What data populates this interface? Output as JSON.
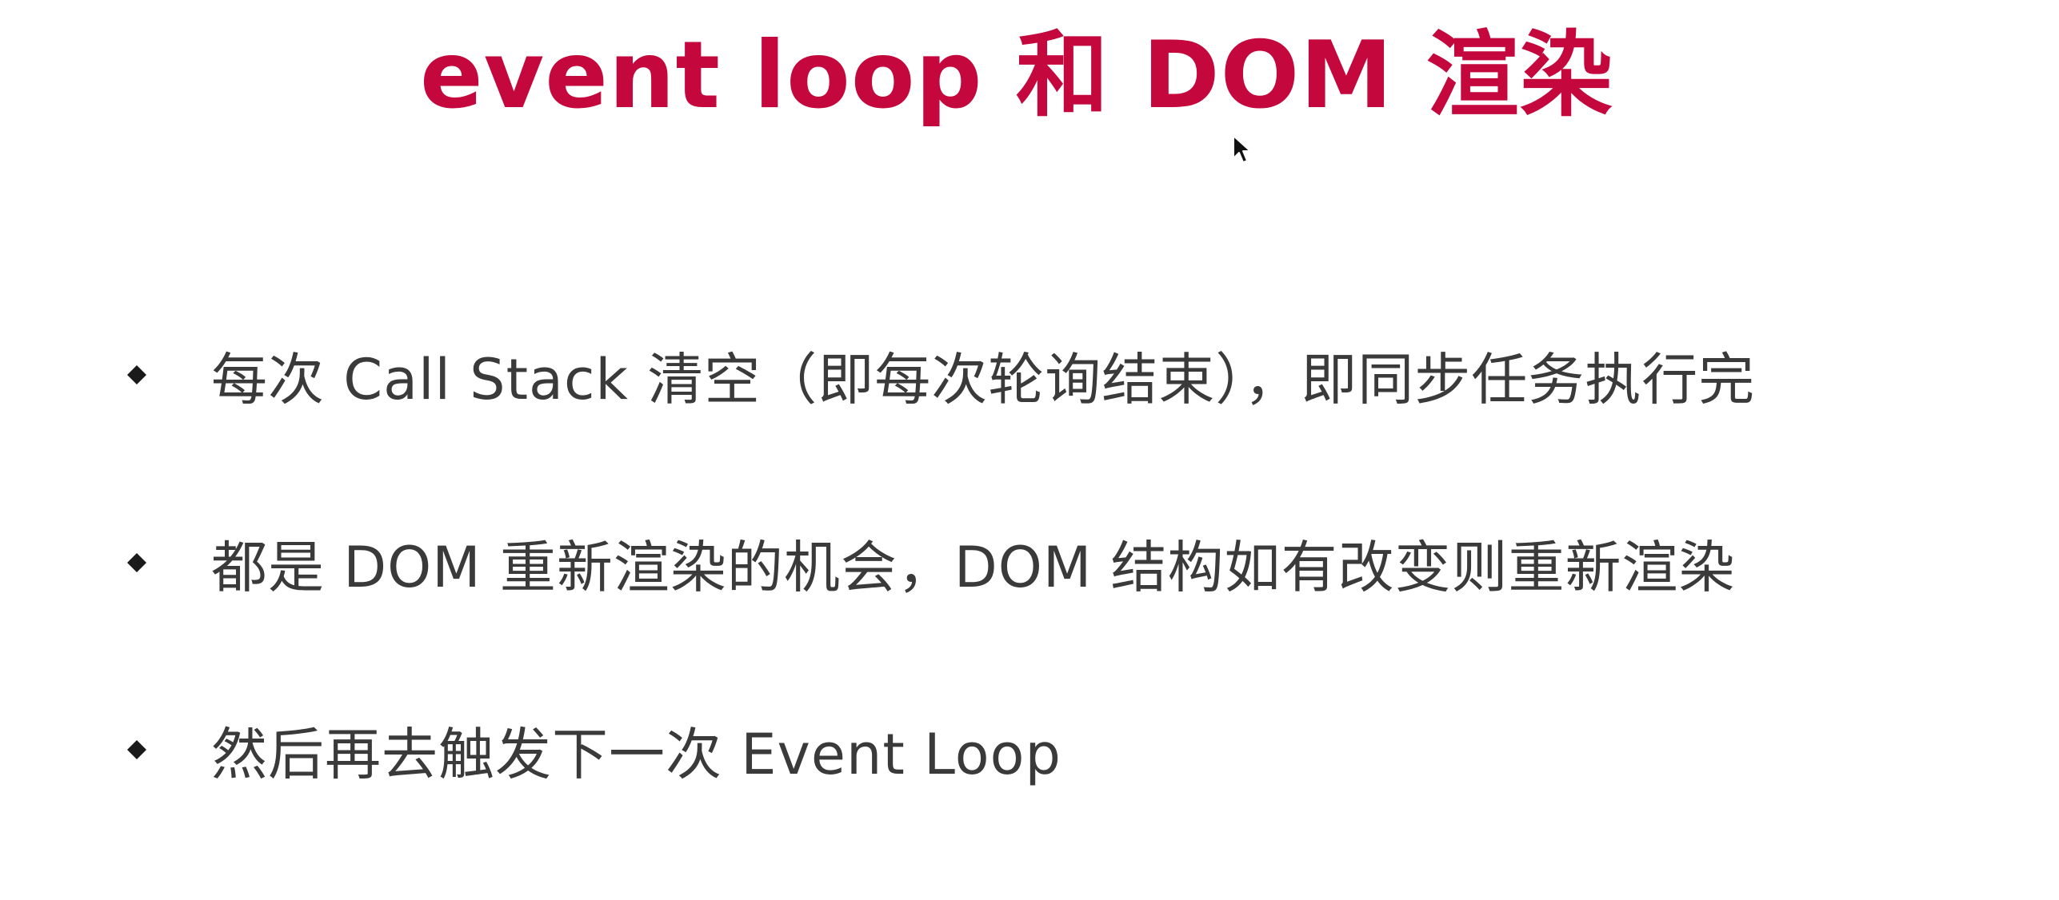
{
  "slide": {
    "title": "event loop 和 DOM 渲染",
    "title_color": "#c4073d",
    "text_color": "#3a3a3a",
    "bullets": [
      {
        "text": "每次 Call Stack 清空（即每次轮询结束），即同步任务执行完",
        "icon": "diamond-bullet-icon"
      },
      {
        "text": "都是 DOM 重新渲染的机会，DOM 结构如有改变则重新渲染",
        "icon": "diamond-bullet-icon"
      },
      {
        "text": "然后再去触发下一次 Event Loop",
        "icon": "diamond-bullet-icon"
      }
    ],
    "cursor_icon": "mouse-pointer-icon"
  }
}
